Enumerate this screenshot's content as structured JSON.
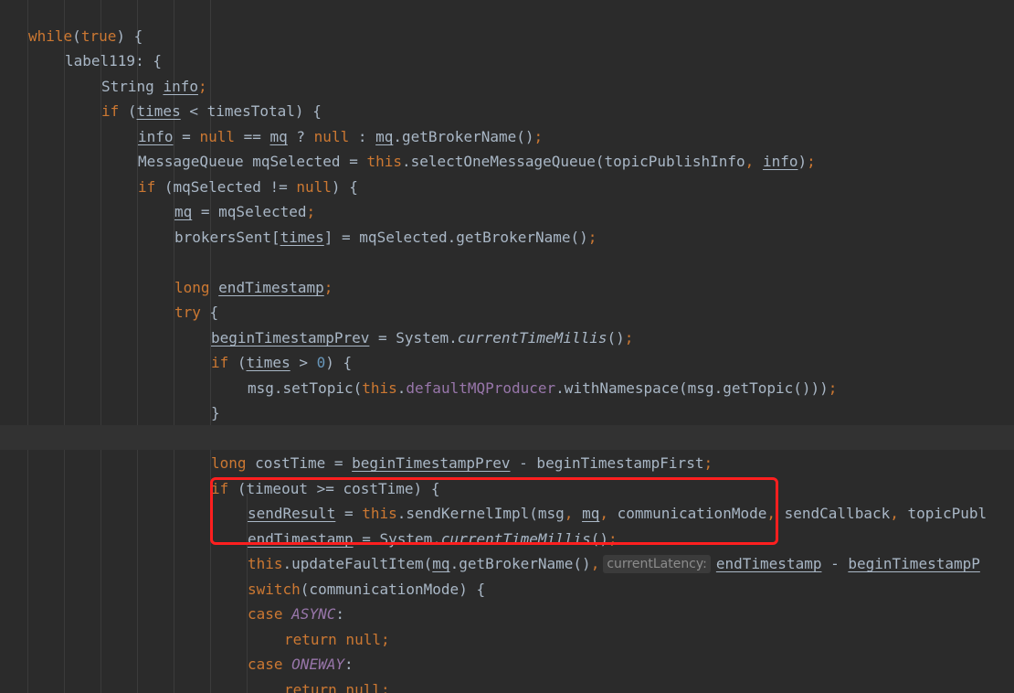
{
  "code": {
    "l1": {
      "a": "while",
      "b": "(",
      "c": "true",
      "d": ") {"
    },
    "l2": {
      "a": "label119: {"
    },
    "l3": {
      "a": "String ",
      "b": "info",
      "c": ";"
    },
    "l4": {
      "a": "if",
      "b": " (",
      "c": "times",
      "d": " < timesTotal) {"
    },
    "l5": {
      "a": "info",
      "b": " = ",
      "c": "null",
      "d": " == ",
      "e": "mq",
      "f": " ? ",
      "g": "null",
      "h": " : ",
      "i": "mq",
      "j": ".getBrokerName()",
      "k": ";"
    },
    "l6": {
      "a": "MessageQueue mqSelected = ",
      "b": "this",
      "c": ".selectOneMessageQueue(topicPublishInfo",
      "d": ", ",
      "e": "info",
      "f": ")",
      "g": ";"
    },
    "l7": {
      "a": "if",
      "b": " (mqSelected != ",
      "c": "null",
      "d": ") {"
    },
    "l8": {
      "a": "mq",
      "b": " = mqSelected",
      "c": ";"
    },
    "l9": {
      "a": "brokersSent[",
      "b": "times",
      "c": "] = mqSelected.getBrokerName()",
      "d": ";"
    },
    "l10": {
      "a": "long ",
      "b": "endTimestamp",
      "c": ";"
    },
    "l11": {
      "a": "try",
      "b": " {"
    },
    "l12": {
      "a": "beginTimestampPrev",
      "b": " = System.",
      "c": "currentTimeMillis",
      "d": "()",
      "e": ";"
    },
    "l13": {
      "a": "if",
      "b": " (",
      "c": "times",
      "d": " > ",
      "e": "0",
      "f": ") {"
    },
    "l14": {
      "a": "msg.setTopic(",
      "b": "this",
      "c": ".",
      "d": "defaultMQProducer",
      "e": ".withNamespace(msg.getTopic()))",
      "f": ";"
    },
    "l15": {
      "a": "}"
    },
    "l17": {
      "a": "long ",
      "b": "costTime = ",
      "c": "beginTimestampPrev",
      "d": " - beginTimestampFirst",
      "e": ";"
    },
    "l18": {
      "a": "if",
      "b": " (timeout >= costTime) {"
    },
    "l19": {
      "a": "sendResult",
      "b": " = ",
      "c": "this",
      "d": ".sendKernelImpl(msg",
      "e": ", ",
      "f": "mq",
      "g": ", ",
      "h": "communicationMode",
      "i": ", ",
      "j": "sendCallback",
      "k": ", ",
      "l": "topicPubl"
    },
    "l20": {
      "a": "endTimestamp",
      "b": " = System.",
      "c": "currentTimeMillis",
      "d": "()",
      "e": ";"
    },
    "l21": {
      "a": "this",
      "b": ".updateFaultItem(",
      "c": "mq",
      "d": ".getBrokerName()",
      "e": ",",
      "hint": "currentLatency:",
      "f": "endTimestamp",
      "g": " - ",
      "h": "beginTimestampP"
    },
    "l22": {
      "a": "switch",
      "b": "(communicationMode) {"
    },
    "l23": {
      "a": "case ",
      "b": "ASYNC",
      "c": ":"
    },
    "l24": {
      "a": "return null",
      "b": ";"
    },
    "l25": {
      "a": "case ",
      "b": "ONEWAY",
      "c": ":"
    },
    "l26": {
      "a": "return null",
      "b": ";"
    }
  },
  "colors": {
    "background": "#2b2b2b",
    "keyword": "#cc7832",
    "field": "#9876aa",
    "number": "#6897bb",
    "text": "#a9b7c6",
    "highlight_box": "#ff1f1f"
  }
}
